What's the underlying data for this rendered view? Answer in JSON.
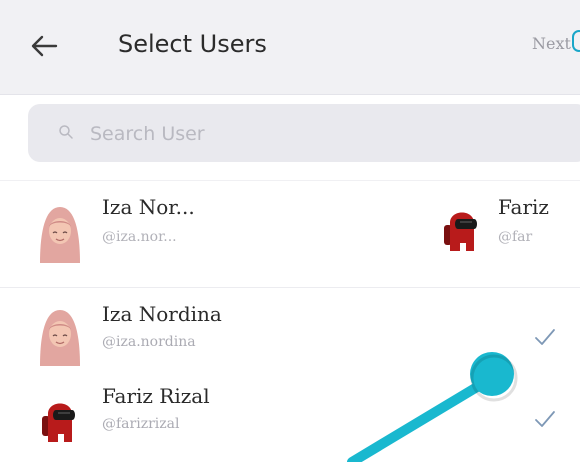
{
  "header": {
    "title": "Select Users",
    "next_label": "Next"
  },
  "search": {
    "placeholder": "Search User",
    "value": ""
  },
  "selected": [
    {
      "name": "Iza Nor...",
      "handle": "@iza.nor..."
    },
    {
      "name": "Fariz",
      "handle": "@far"
    }
  ],
  "users": [
    {
      "name": "Iza Nordina",
      "handle": "@iza.nordina",
      "selected": true
    },
    {
      "name": "Fariz Rizal",
      "handle": "@farizrizal",
      "selected": true
    }
  ],
  "colors": {
    "accent": "#19b8cf",
    "header_bg": "#f1f1f4",
    "search_bg": "#e9e9ee",
    "check": "#7e98b6"
  },
  "icons": {
    "back": "arrow-left-icon",
    "search": "search-icon",
    "check": "check-icon"
  }
}
